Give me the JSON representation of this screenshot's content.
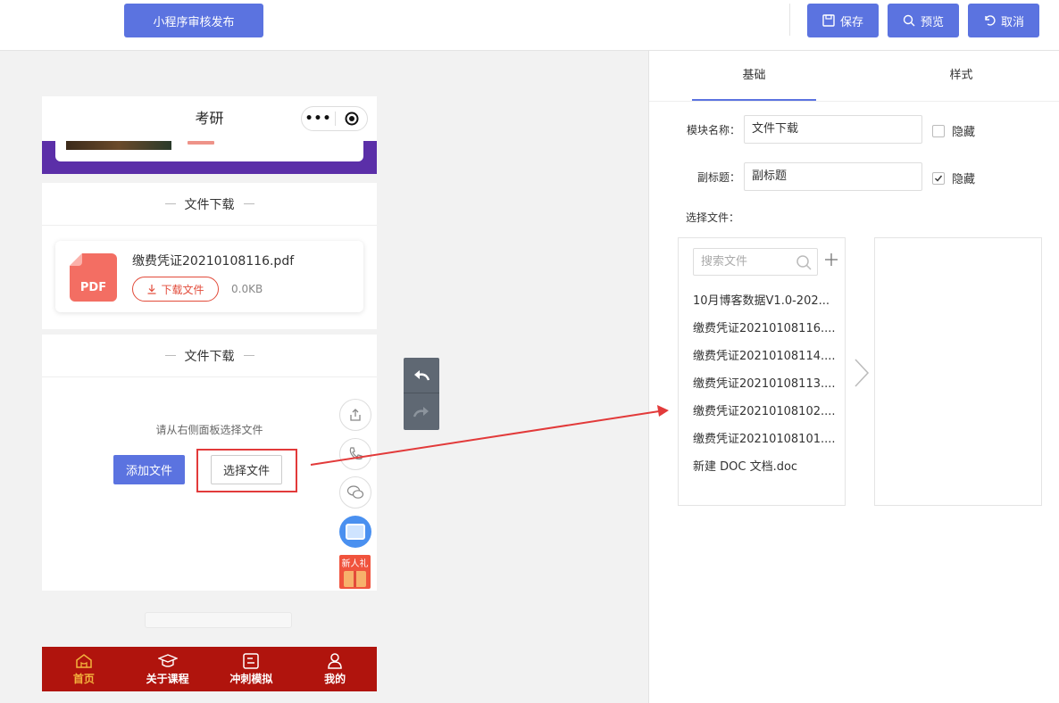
{
  "toolbar": {
    "publish_label": "小程序审核发布",
    "save_label": "保存",
    "preview_label": "预览",
    "cancel_label": "取消"
  },
  "phone": {
    "title": "考研",
    "capsule_menu": "•••",
    "module1": {
      "title": "文件下载",
      "file_name": "缴费凭证20210108116.pdf",
      "download_label": "下载文件",
      "file_size": "0.0KB",
      "file_icon_text": "PDF"
    },
    "module2": {
      "title": "文件下载",
      "hint": "请从右侧面板选择文件",
      "add_label": "添加文件",
      "select_label": "选择文件"
    },
    "gift_label": "新人礼",
    "tabs": [
      {
        "label": "首页",
        "icon": "home-icon"
      },
      {
        "label": "关于课程",
        "icon": "graduation-cap-icon"
      },
      {
        "label": "冲刺模拟",
        "icon": "exam-icon"
      },
      {
        "label": "我的",
        "icon": "user-icon"
      }
    ],
    "colors": {
      "accent": "#5b2fa8",
      "tabbar": "#b0140d",
      "tab_active": "#f3b33d",
      "danger": "#e24b3a"
    }
  },
  "panel": {
    "tabs": {
      "basic": "基础",
      "style": "样式"
    },
    "module_name_label": "模块名称：",
    "module_name_value": "文件下载",
    "subtitle_label": "副标题：",
    "subtitle_value": "副标题",
    "hide_label": "隐藏",
    "hide_subtitle_label": "隐藏",
    "hide_module_checked": false,
    "hide_subtitle_checked": true,
    "select_files_label": "选择文件：",
    "search_placeholder": "搜索文件",
    "files": [
      "10月博客数据V1.0-202...",
      "缴费凭证20210108116....",
      "缴费凭证20210108114....",
      "缴费凭证20210108113....",
      "缴费凭证20210108102....",
      "缴费凭证20210108101....",
      "新建 DOC 文档.doc"
    ]
  },
  "colors": {
    "primary": "#5b73e0",
    "annotation": "#e23a3a"
  }
}
